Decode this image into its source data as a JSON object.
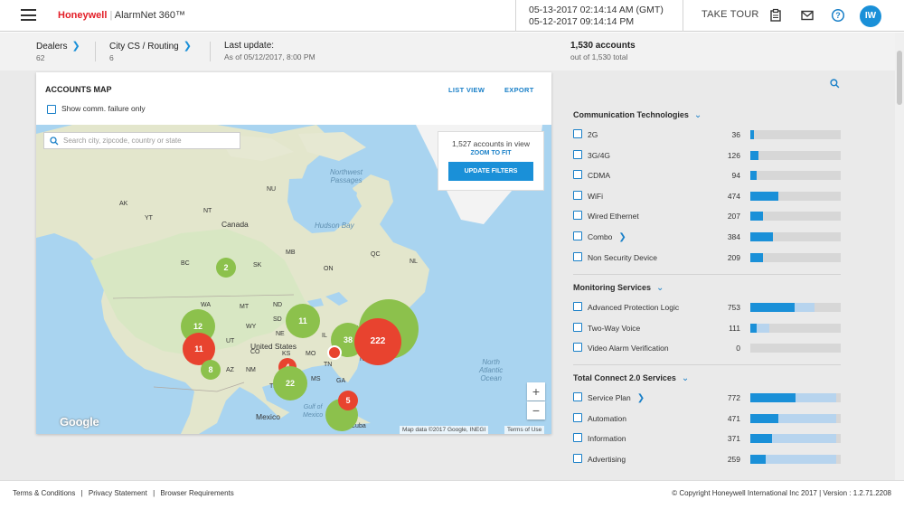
{
  "header": {
    "logo_brand": "Honeywell",
    "logo_product": "AlarmNet 360™",
    "time_gmt": "05-13-2017 02:14:14 AM (GMT)",
    "time_local": "05-12-2017 09:14:14 PM",
    "take_tour": "TAKE TOUR",
    "avatar_initials": "IW"
  },
  "subbar": {
    "dealers_label": "Dealers",
    "dealers_count": "62",
    "city_label": "City CS / Routing",
    "city_count": "6",
    "last_update_label": "Last update:",
    "last_update_value": "As of 05/12/2017, 8:00 PM",
    "accounts_label": "1,530 accounts",
    "accounts_sub": "out of 1,530 total"
  },
  "map_panel": {
    "title": "ACCOUNTS MAP",
    "list_view": "LIST VIEW",
    "export": "EXPORT",
    "comm_failure": "Show comm. failure only",
    "search_placeholder": "Search city, zipcode, country or state",
    "in_view": "1,527 accounts in view",
    "zoom_to_fit": "ZOOM TO FIT",
    "update_filters": "UPDATE FILTERS",
    "zoom_in": "+",
    "zoom_out": "−",
    "google": "Google",
    "map_data": "Map data ©2017 Google, INEGI",
    "terms_of_use": "Terms of Use",
    "labels": {
      "canada": "Canada",
      "united_states": "United States",
      "mexico": "Mexico",
      "hudson_bay": "Hudson Bay",
      "northwest_passages": "Northwest\nPassages",
      "north_atlantic": "North\nAtlantic\nOcean",
      "gulf_mexico": "Gulf of\nMexico",
      "cuba": "Cuba",
      "ak": "AK",
      "nu": "NU",
      "yt": "YT",
      "nt": "NT",
      "bc": "BC",
      "ab": "AB",
      "sk": "SK",
      "mb": "MB",
      "on": "ON",
      "qc": "QC",
      "nl": "NL",
      "wa": "WA",
      "mt": "MT",
      "nd": "ND",
      "mn": "MN",
      "sd": "SD",
      "wy": "WY",
      "ne": "NE",
      "ia": "IA",
      "il": "IL",
      "oh": "OH",
      "ca": "CA",
      "nv": "NV",
      "ut": "UT",
      "co": "CO",
      "ks": "KS",
      "mo": "MO",
      "az": "AZ",
      "nm": "NM",
      "ok": "OK",
      "tx": "TX",
      "tn": "TN",
      "nc": "NC",
      "ms": "MS",
      "ga": "GA"
    },
    "clusters": [
      {
        "label": "2",
        "color": "#8cc14c"
      },
      {
        "label": "12",
        "color": "#8cc14c"
      },
      {
        "label": "11",
        "color": "#e8432f"
      },
      {
        "label": "8",
        "color": "#8cc14c"
      },
      {
        "label": "11",
        "color": "#8cc14c"
      },
      {
        "label": "4",
        "color": "#e8432f"
      },
      {
        "label": "22",
        "color": "#8cc14c"
      },
      {
        "label": "38",
        "color": "#8cc14c"
      },
      {
        "label": "222",
        "color": "#e8432f"
      },
      {
        "label": "5",
        "color": "#e8432f"
      }
    ]
  },
  "filters": {
    "sections": [
      {
        "title": "Communication Technologies",
        "items": [
          {
            "label": "2G",
            "value": "36",
            "primary": 0.036,
            "secondary": 0.036
          },
          {
            "label": "3G/4G",
            "value": "126",
            "primary": 0.09,
            "secondary": 0.09
          },
          {
            "label": "CDMA",
            "value": "94",
            "primary": 0.07,
            "secondary": 0.07
          },
          {
            "label": "WiFi",
            "value": "474",
            "primary": 0.31,
            "secondary": 0.31
          },
          {
            "label": "Wired Ethernet",
            "value": "207",
            "primary": 0.14,
            "secondary": 0.14
          },
          {
            "label": "Combo",
            "value": "384",
            "primary": 0.25,
            "secondary": 0.25
          },
          {
            "label": "Non Security Device",
            "value": "209",
            "primary": 0.14,
            "secondary": 0.14
          }
        ]
      },
      {
        "title": "Monitoring Services",
        "items": [
          {
            "label": "Advanced Protection Logic",
            "value": "753",
            "primary": 0.49,
            "secondary": 0.71
          },
          {
            "label": "Two-Way Voice",
            "value": "111",
            "primary": 0.07,
            "secondary": 0.21
          },
          {
            "label": "Video Alarm Verification",
            "value": "0",
            "primary": 0,
            "secondary": 0
          }
        ]
      },
      {
        "title": "Total Connect 2.0 Services",
        "items": [
          {
            "label": "Service Plan",
            "value": "772",
            "primary": 0.5,
            "secondary": 0.95
          },
          {
            "label": "Automation",
            "value": "471",
            "primary": 0.31,
            "secondary": 0.95
          },
          {
            "label": "Information",
            "value": "371",
            "primary": 0.24,
            "secondary": 0.95
          },
          {
            "label": "Advertising",
            "value": "259",
            "primary": 0.17,
            "secondary": 0.95
          }
        ]
      }
    ]
  },
  "footer": {
    "terms": "Terms & Conditions",
    "privacy": "Privacy Statement",
    "browser": "Browser Requirements",
    "copyright": "© Copyright Honeywell International Inc 2017 | Version : 1.2.71.2208"
  },
  "colors": {
    "accent": "#1a90d8",
    "brand_red": "#e31e27",
    "cluster_green": "#8cc14c",
    "cluster_red": "#e8432f"
  }
}
